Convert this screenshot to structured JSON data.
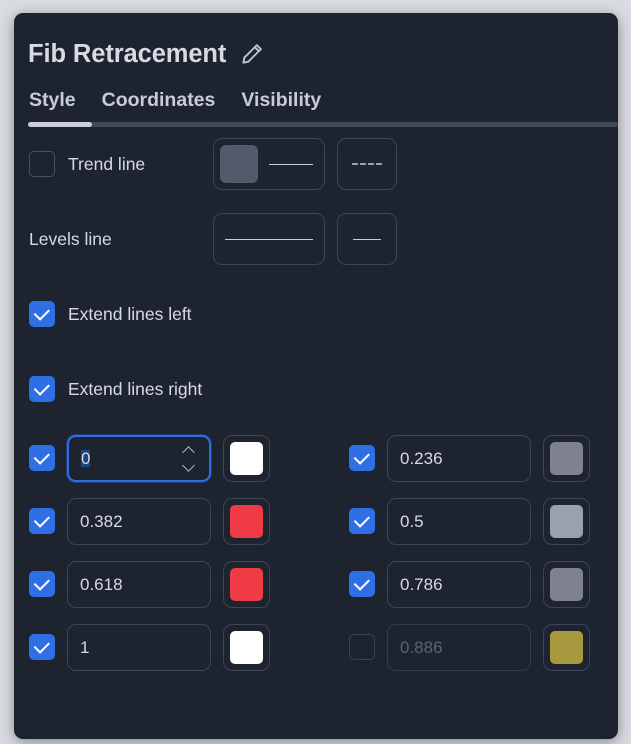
{
  "header": {
    "title": "Fib Retracement",
    "edit_icon": "pencil-icon"
  },
  "tabs": [
    {
      "label": "Style",
      "active": true
    },
    {
      "label": "Coordinates",
      "active": false
    },
    {
      "label": "Visibility",
      "active": false
    }
  ],
  "style_rows": {
    "trend_line": {
      "label": "Trend line",
      "checked": false,
      "color": "#555a6b",
      "line_style": "solid",
      "dash_button": "dashed"
    },
    "levels_line": {
      "label": "Levels line",
      "line_style": "solid",
      "line_color": "#c6cbd7",
      "width_button": "solid-short"
    },
    "extend_left": {
      "label": "Extend lines left",
      "checked": true
    },
    "extend_right": {
      "label": "Extend lines right",
      "checked": true
    }
  },
  "levels": [
    {
      "checked": true,
      "value": "0",
      "color": "#ffffff",
      "focused": true,
      "disabled": false
    },
    {
      "checked": true,
      "value": "0.236",
      "color": "#7e8190",
      "focused": false,
      "disabled": false
    },
    {
      "checked": true,
      "value": "0.382",
      "color": "#ef3b45",
      "focused": false,
      "disabled": false
    },
    {
      "checked": true,
      "value": "0.5",
      "color": "#9aa0ae",
      "focused": false,
      "disabled": false
    },
    {
      "checked": true,
      "value": "0.618",
      "color": "#ef3b45",
      "focused": false,
      "disabled": false
    },
    {
      "checked": true,
      "value": "0.786",
      "color": "#7e8190",
      "focused": false,
      "disabled": false
    },
    {
      "checked": true,
      "value": "1",
      "color": "#ffffff",
      "focused": false,
      "disabled": false
    },
    {
      "checked": false,
      "value": "0.886",
      "color": "#a8993f",
      "focused": false,
      "disabled": true
    }
  ],
  "colors": {
    "panel_bg": "#1e2330",
    "page_bg": "#d9dce1",
    "accent": "#2f6fe4",
    "text": "#d6dae3",
    "border": "#3d4455",
    "tabbar": "#414859",
    "tab_active": "#c8cdd9"
  }
}
